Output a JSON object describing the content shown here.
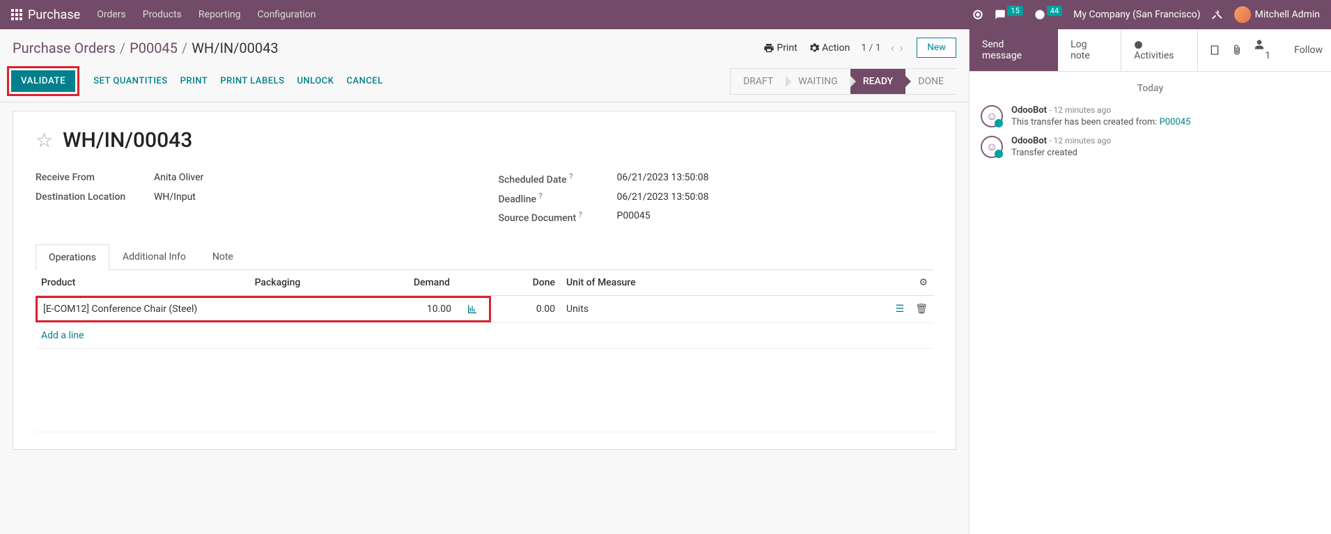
{
  "topbar": {
    "app": "Purchase",
    "menu": [
      "Orders",
      "Products",
      "Reporting",
      "Configuration"
    ],
    "msg_badge": "15",
    "clock_badge": "44",
    "company": "My Company (San Francisco)",
    "user": "Mitchell Admin"
  },
  "breadcrumb": {
    "root": "Purchase Orders",
    "parent": "P00045",
    "current": "WH/IN/00043",
    "print": "Print",
    "action": "Action",
    "pager": "1 / 1",
    "new_btn": "New"
  },
  "actions": {
    "validate": "VALIDATE",
    "set_qty": "SET QUANTITIES",
    "print": "PRINT",
    "print_labels": "PRINT LABELS",
    "unlock": "UNLOCK",
    "cancel": "CANCEL"
  },
  "status": {
    "draft": "DRAFT",
    "waiting": "WAITING",
    "ready": "READY",
    "done": "DONE"
  },
  "record": {
    "title": "WH/IN/00043",
    "labels": {
      "receive_from": "Receive From",
      "dest_loc": "Destination Location",
      "sched_date": "Scheduled Date",
      "deadline": "Deadline",
      "src_doc": "Source Document"
    },
    "receive_from": "Anita Oliver",
    "dest_loc": "WH/Input",
    "sched_date": "06/21/2023 13:50:08",
    "deadline": "06/21/2023 13:50:08",
    "src_doc": "P00045"
  },
  "tabs": {
    "ops": "Operations",
    "addl": "Additional Info",
    "note": "Note"
  },
  "table": {
    "headers": {
      "product": "Product",
      "packaging": "Packaging",
      "demand": "Demand",
      "done": "Done",
      "uom": "Unit of Measure"
    },
    "rows": [
      {
        "product": "[E-COM12] Conference Chair (Steel)",
        "packaging": "",
        "demand": "10.00",
        "done": "0.00",
        "uom": "Units"
      }
    ],
    "add_line": "Add a line"
  },
  "chatter": {
    "send": "Send message",
    "log": "Log note",
    "activities": "Activities",
    "followers": "1",
    "follow": "Follow",
    "today": "Today",
    "msgs": [
      {
        "author": "OdooBot",
        "time": "- 12 minutes ago",
        "body_prefix": "This transfer has been created from: ",
        "link": "P00045"
      },
      {
        "author": "OdooBot",
        "time": "- 12 minutes ago",
        "body": "Transfer created"
      }
    ]
  }
}
